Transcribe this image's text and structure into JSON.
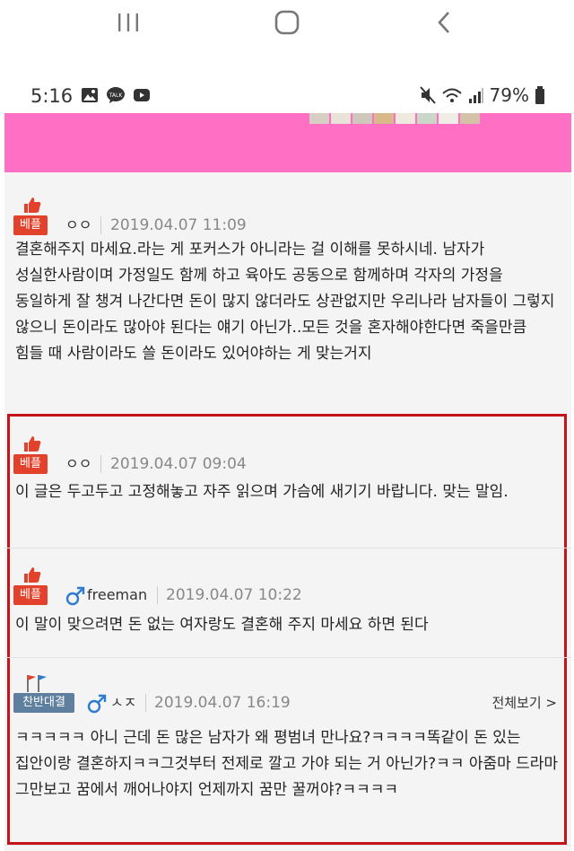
{
  "nav": {
    "recents_label": "III",
    "home_label": "home",
    "back_label": "back"
  },
  "status": {
    "time": "5:16",
    "battery": "79%"
  },
  "colors": {
    "banner": "#ff6fc4",
    "best_badge": "#e2412b",
    "highlight": "#c4141a",
    "flag_badge": "#5f7f9e"
  },
  "comments": [
    {
      "badge": "베플",
      "nick": "ㅇㅇ",
      "date": "2019.04.07 11:09",
      "text": "결혼해주지 마세요.라는 게 포커스가 아니라는 걸 이해를 못하시네. 남자가 성실한사람이며 가정일도 함께 하고 육아도 공동으로 함께하며 각자의 가정을 동일하게 잘 챙겨 나간다면 돈이 많지 않더라도 상관없지만 우리나라 남자들이 그렇지 않으니 돈이라도 많아야 된다는 얘기 아닌가..모든 것을 혼자해야한다면 죽을만큼 힘들 때 사람이라도 쓸 돈이라도 있어야하는 게 맞는거지"
    },
    {
      "badge": "베플",
      "nick": "ㅇㅇ",
      "date": "2019.04.07 09:04",
      "text": "이 글은 두고두고 고정해놓고 자주 읽으며 가슴에 새기기 바랍니다. 맞는 말임."
    },
    {
      "badge": "베플",
      "nick": "freeman",
      "date": "2019.04.07 10:22",
      "text": "이 말이 맞으려면 돈 없는 여자랑도 결혼해 주지 마세요 하면 된다"
    },
    {
      "badge": "찬반대결",
      "nick": "ㅅㅈ",
      "date": "2019.04.07 16:19",
      "see_all": "전체보기 >",
      "text": "ㅋㅋㅋㅋㅋ 아니 근데 돈 많은 남자가 왜 평범녀 만나요?ㅋㅋㅋㅋ똑같이 돈 있는 집안이랑 결혼하지ㅋㅋ그것부터 전제로 깔고 가야 되는 거 아닌가?ㅋㅋ 아줌마 드라마 그만보고 꿈에서 깨어나야지 언제까지 꿈만 꿀꺼야?ㅋㅋㅋㅋ"
    }
  ]
}
